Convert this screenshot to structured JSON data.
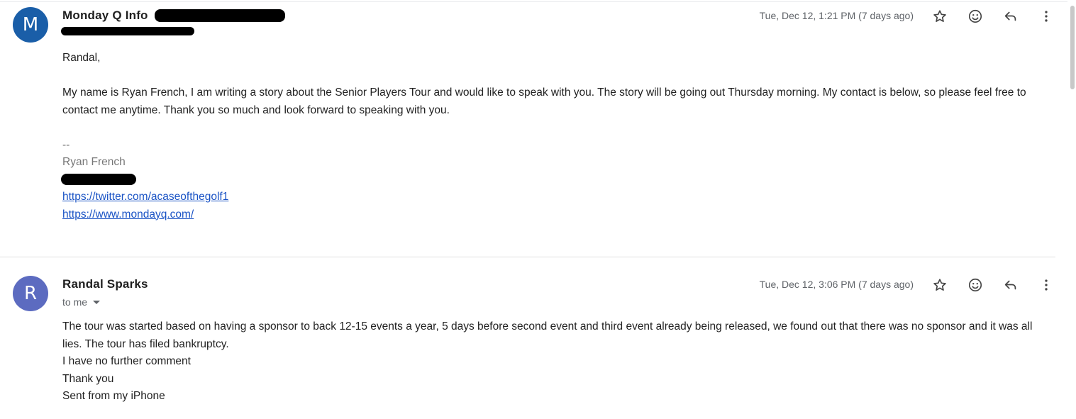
{
  "messages": [
    {
      "avatar_letter": "M",
      "sender": "Monday Q Info",
      "date": "Tue, Dec 12, 1:21 PM (7 days ago)",
      "greeting": "Randal,",
      "paragraph": "My name is Ryan French, I am writing a story about the Senior Players Tour and would like to speak with you. The story will be going out Thursday morning. My contact is below, so please feel free to contact me anytime. Thank you so much and look forward to speaking with you.",
      "signature_separator": "--",
      "signature_name": "Ryan French",
      "links": [
        "https://twitter.com/acaseofthegolf1",
        "https://www.mondayq.com/"
      ]
    },
    {
      "avatar_letter": "R",
      "sender": "Randal Sparks",
      "to_label": "to me",
      "date": "Tue, Dec 12, 3:06 PM (7 days ago)",
      "lines": [
        "The tour was started based on having a sponsor to back 12-15 events a year, 5 days before second event and third event already being released, we found out that there was no sponsor and it was all lies. The tour has filed bankruptcy.",
        "I have no further comment",
        "Thank you",
        "Sent from my iPhone"
      ]
    }
  ],
  "icons": {
    "star": "star-icon",
    "emoji": "add-reaction-icon",
    "reply": "reply-icon",
    "more": "more-vert-icon"
  }
}
